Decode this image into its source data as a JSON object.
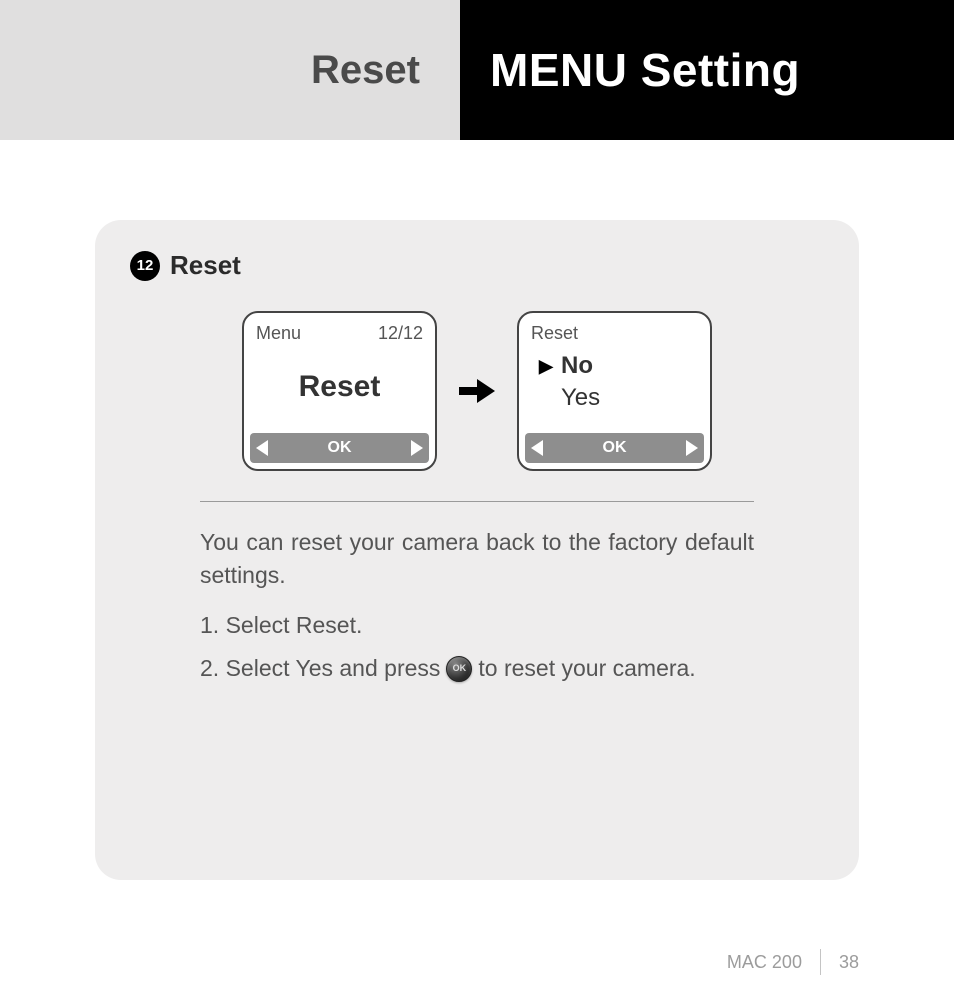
{
  "header": {
    "left": "Reset",
    "right": "MENU Setting"
  },
  "section": {
    "number": "12",
    "title": "Reset"
  },
  "screen1": {
    "top_left": "Menu",
    "top_right": "12/12",
    "main": "Reset",
    "ok": "OK"
  },
  "screen2": {
    "top_left": "Reset",
    "option_no": "No",
    "option_yes": "Yes",
    "ok": "OK"
  },
  "description": "You can reset your camera back to the factory default settings.",
  "step1": "1. Select Reset.",
  "step2_a": "2. Select Yes and press",
  "step2_b": "to reset your camera.",
  "ok_button_label": "OK",
  "footer": {
    "model": "MAC 200",
    "page": "38"
  }
}
